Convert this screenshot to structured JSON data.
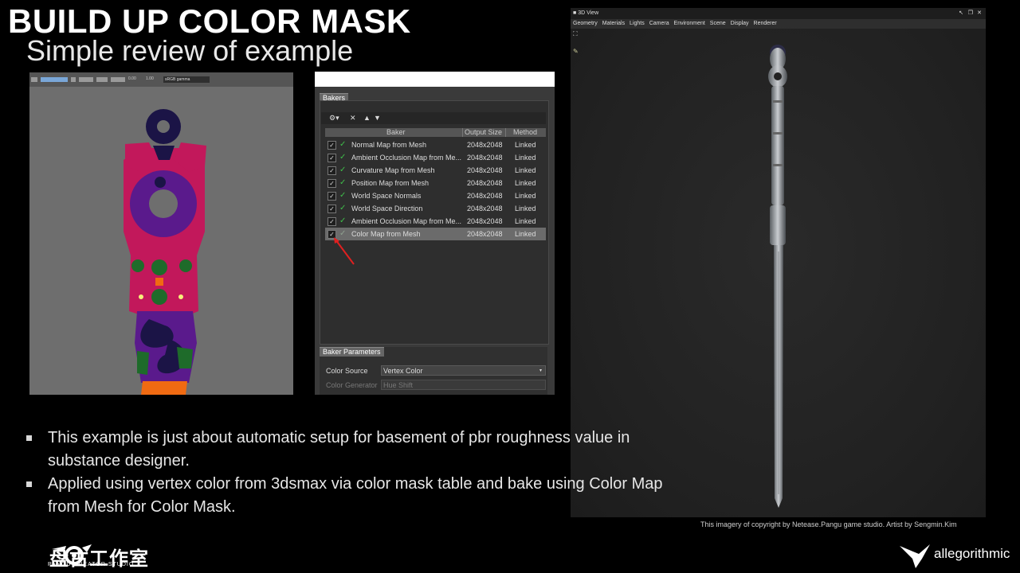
{
  "slide": {
    "title": "BUILD UP COLOR MASK",
    "subtitle": "Simple review of example",
    "bullets": [
      "This example is just about automatic setup for basement of pbr roughness value in substance designer.",
      "Applied using vertex color from 3dsmax via color mask table and bake using Color Map from Mesh for Color Mask."
    ],
    "copyright": "This imagery of copyright by Netease.Pangu game studio. Artist by Sengmin.Kim",
    "pangu_logo": {
      "name": "盘古工作室",
      "sub": "PANGU CREATOR STUDIO"
    },
    "allegorithmic_logo": "allegorithmic"
  },
  "mask_view": {
    "toolbar_values": [
      "0.00",
      "1.00"
    ],
    "gamma": "sRGB gamma",
    "colors": {
      "background": "#6e6e6e",
      "magenta": "#c2185b",
      "purple": "#5a1a8c",
      "navy": "#1b1446",
      "green": "#1e6b2a",
      "orange": "#f06a12",
      "yellow": "#f6f17a"
    }
  },
  "bakers": {
    "section_title": "Bakers",
    "columns": [
      "Baker",
      "Output Size",
      "Method"
    ],
    "rows": [
      {
        "name": "Normal Map from Mesh",
        "size": "2048x2048",
        "method": "Linked"
      },
      {
        "name": "Ambient Occlusion Map from Me...",
        "size": "2048x2048",
        "method": "Linked"
      },
      {
        "name": "Curvature Map from Mesh",
        "size": "2048x2048",
        "method": "Linked"
      },
      {
        "name": "Position Map from Mesh",
        "size": "2048x2048",
        "method": "Linked"
      },
      {
        "name": "World Space Normals",
        "size": "2048x2048",
        "method": "Linked"
      },
      {
        "name": "World Space Direction",
        "size": "2048x2048",
        "method": "Linked"
      },
      {
        "name": "Ambient Occlusion Map from Me...",
        "size": "2048x2048",
        "method": "Linked"
      },
      {
        "name": "Color Map from Mesh",
        "size": "2048x2048",
        "method": "Linked",
        "selected": true
      }
    ],
    "params_title": "Baker Parameters",
    "color_source_label": "Color Source",
    "color_source_value": "Vertex Color",
    "color_generator_label": "Color Generator",
    "color_generator_value": "Hue Shift",
    "highlight_color": "#e02020"
  },
  "view3d": {
    "title": "3D View",
    "menu": [
      "Geometry",
      "Materials",
      "Lights",
      "Camera",
      "Environment",
      "Scene",
      "Display",
      "Renderer"
    ]
  }
}
